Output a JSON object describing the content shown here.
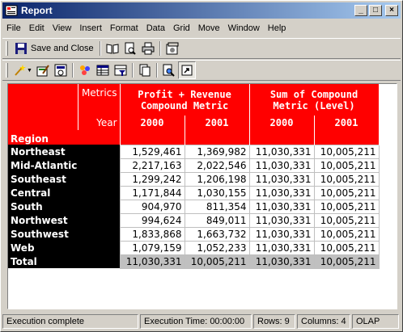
{
  "window": {
    "title": "Report"
  },
  "menu": [
    "File",
    "Edit",
    "View",
    "Insert",
    "Format",
    "Data",
    "Grid",
    "Move",
    "Window",
    "Help"
  ],
  "toolbar": {
    "save_close_label": "Save and Close"
  },
  "grid": {
    "header": {
      "metrics_label": "Metrics",
      "year_label": "Year",
      "region_label": "Region",
      "metric1_line1": "Profit + Revenue",
      "metric1_line2": "Compound Metric",
      "metric2_line1": "Sum of Compound",
      "metric2_line2": "Metric (Level)",
      "years": [
        "2000",
        "2001",
        "2000",
        "2001"
      ]
    },
    "rows": [
      {
        "region": "Northeast",
        "v": [
          "1,529,461",
          "1,369,982",
          "11,030,331",
          "10,005,211"
        ]
      },
      {
        "region": "Mid-Atlantic",
        "v": [
          "2,217,163",
          "2,022,546",
          "11,030,331",
          "10,005,211"
        ]
      },
      {
        "region": "Southeast",
        "v": [
          "1,299,242",
          "1,206,198",
          "11,030,331",
          "10,005,211"
        ]
      },
      {
        "region": "Central",
        "v": [
          "1,171,844",
          "1,030,155",
          "11,030,331",
          "10,005,211"
        ]
      },
      {
        "region": "South",
        "v": [
          "904,970",
          "811,354",
          "11,030,331",
          "10,005,211"
        ]
      },
      {
        "region": "Northwest",
        "v": [
          "994,624",
          "849,011",
          "11,030,331",
          "10,005,211"
        ]
      },
      {
        "region": "Southwest",
        "v": [
          "1,833,868",
          "1,663,732",
          "11,030,331",
          "10,005,211"
        ]
      },
      {
        "region": "Web",
        "v": [
          "1,079,159",
          "1,052,233",
          "11,030,331",
          "10,005,211"
        ]
      }
    ],
    "total": {
      "region": "Total",
      "v": [
        "11,030,331",
        "10,005,211",
        "11,030,331",
        "10,005,211"
      ]
    }
  },
  "status": {
    "message": "Execution complete",
    "exec_time": "Execution Time: 00:00:00",
    "rows": "Rows: 9",
    "columns": "Columns: 4",
    "mode": "OLAP"
  },
  "colors": {
    "header_bg": "#ff0000",
    "row_header_bg": "#000000",
    "total_bg": "#c0c0c0",
    "title_bar": "#0a246a"
  }
}
